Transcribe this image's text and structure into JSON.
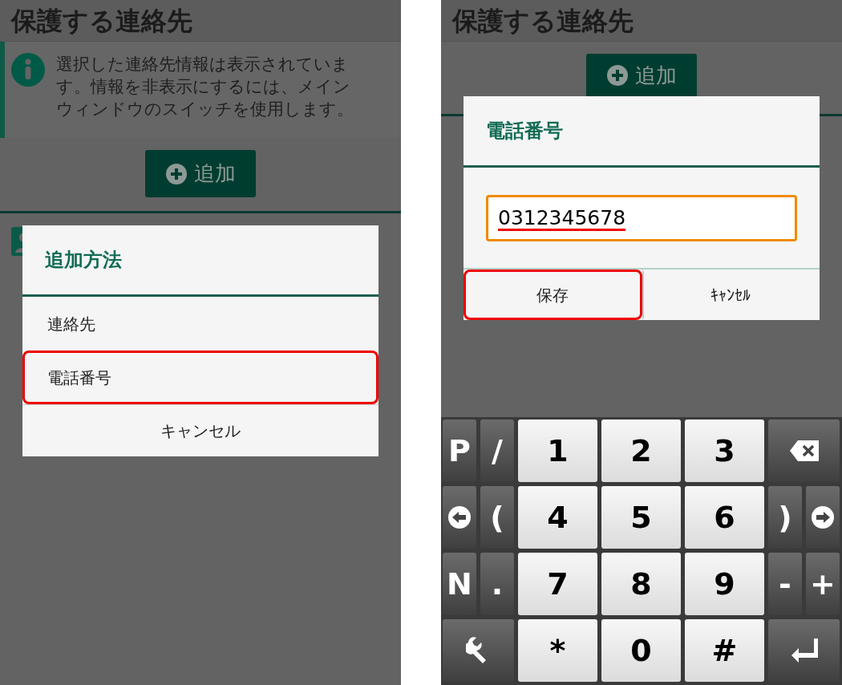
{
  "left_screen": {
    "title": "保護する連絡先",
    "info": "選択した連絡先情報は表示されています。情報を非表示にするには、メインウィンドウのスイッチを使用します。",
    "add_button": "追加",
    "dialog": {
      "title": "追加方法",
      "items": [
        {
          "label": "連絡先",
          "highlighted": false
        },
        {
          "label": "電話番号",
          "highlighted": true
        }
      ],
      "cancel": "キャンセル"
    }
  },
  "right_screen": {
    "title": "保護する連絡先",
    "add_button": "追加",
    "dialog": {
      "title": "電話番号",
      "input": {
        "value": "0312345678",
        "underlined": true
      },
      "buttons": [
        {
          "label": "保存",
          "highlighted": true
        },
        {
          "label": "ｷｬﾝｾﾙ",
          "highlighted": false
        }
      ]
    },
    "keyboard": {
      "left_keys": [
        [
          {
            "kind": "symbol",
            "label": "P"
          },
          {
            "kind": "symbol",
            "label": "/"
          }
        ],
        [
          {
            "kind": "left"
          },
          {
            "kind": "symbol",
            "label": "("
          }
        ],
        [
          {
            "kind": "symbol",
            "label": "N"
          },
          {
            "kind": "symbol",
            "label": "."
          }
        ],
        [
          {
            "kind": "tool"
          }
        ]
      ],
      "number_keys": [
        [
          {
            "kind": "digit",
            "label": "1"
          },
          {
            "kind": "digit",
            "label": "2"
          },
          {
            "kind": "digit",
            "label": "3"
          }
        ],
        [
          {
            "kind": "digit",
            "label": "4"
          },
          {
            "kind": "digit",
            "label": "5"
          },
          {
            "kind": "digit",
            "label": "6"
          }
        ],
        [
          {
            "kind": "digit",
            "label": "7"
          },
          {
            "kind": "digit",
            "label": "8"
          },
          {
            "kind": "digit",
            "label": "9"
          }
        ],
        [
          {
            "kind": "digit",
            "label": "*"
          },
          {
            "kind": "digit",
            "label": "0"
          },
          {
            "kind": "digit",
            "label": "#"
          }
        ]
      ],
      "right_keys": [
        [
          {
            "kind": "backspace"
          }
        ],
        [
          {
            "kind": "symbol",
            "label": ")"
          },
          {
            "kind": "right"
          }
        ],
        [
          {
            "kind": "symbol",
            "label": "-"
          },
          {
            "kind": "symbol",
            "label": "+"
          }
        ],
        [
          {
            "kind": "enter"
          }
        ]
      ]
    }
  }
}
